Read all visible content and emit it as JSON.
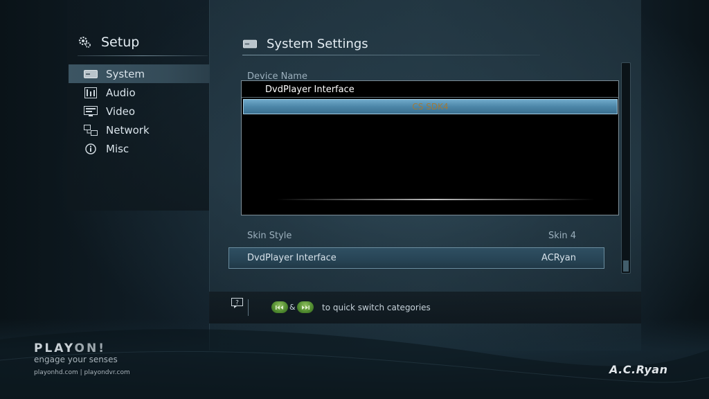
{
  "sidebar": {
    "title": "Setup",
    "items": [
      {
        "label": "System",
        "icon": "system-icon"
      },
      {
        "label": "Audio",
        "icon": "audio-icon"
      },
      {
        "label": "Video",
        "icon": "video-icon"
      },
      {
        "label": "Network",
        "icon": "network-icon"
      },
      {
        "label": "Misc",
        "icon": "info-icon"
      }
    ],
    "active": "System"
  },
  "main": {
    "title": "System Settings",
    "device_name": {
      "label": "Device Name",
      "options": [
        "DvdPlayer Interface",
        "CS SDK4"
      ],
      "selected": "CS SDK4"
    },
    "skin_style": {
      "label": "Skin Style",
      "value": "Skin 4"
    },
    "option_row": {
      "name": "DvdPlayer Interface",
      "value": "ACRyan"
    }
  },
  "hint": {
    "amp": "&",
    "text": "to quick switch categories"
  },
  "brand": {
    "logo_a": "PLAY",
    "logo_b": "ON!",
    "tagline": "engage your senses",
    "urls": "playonhd.com | playondvr.com",
    "maker": "A.C.Ryan"
  },
  "colors": {
    "selection": "#4c86a8",
    "button_green": "#4f8a2f",
    "accent_text": "#a07a3a"
  }
}
